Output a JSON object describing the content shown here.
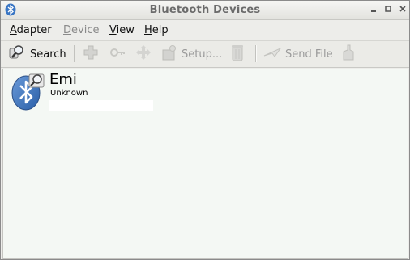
{
  "window": {
    "title": "Bluetooth Devices"
  },
  "menubar": {
    "items": [
      {
        "label": "Adapter",
        "enabled": true
      },
      {
        "label": "Device",
        "enabled": false
      },
      {
        "label": "View",
        "enabled": true
      },
      {
        "label": "Help",
        "enabled": true
      }
    ]
  },
  "toolbar": {
    "search_label": "Search",
    "setup_label": "Setup...",
    "send_file_label": "Send File"
  },
  "devices": [
    {
      "name": "Emi",
      "type": "Unknown",
      "icon": "bluetooth-search-icon"
    }
  ],
  "colors": {
    "bluetooth_blue": "#3a76c4",
    "list_background": "#f4f8f4"
  }
}
